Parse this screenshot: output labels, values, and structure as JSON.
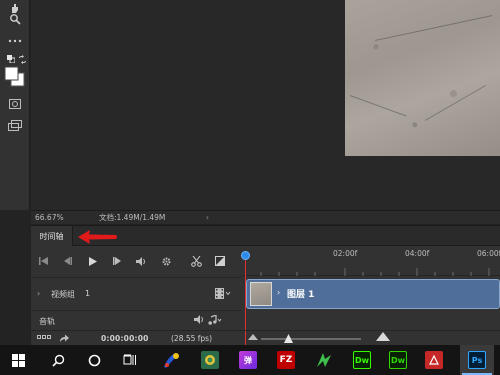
{
  "toolbar": {
    "tools": [
      "hand-tool",
      "zoom-tool",
      "more-tools",
      "default-colors",
      "swap-colors",
      "foreground-background-colors",
      "quick-mask",
      "screen-mode"
    ]
  },
  "status": {
    "zoom": "66.67%",
    "doc_info": "文档:1.49M/1.49M",
    "arrow": "›"
  },
  "timeline": {
    "tab_label": "时间轴",
    "ruler_labels": [
      "02:00f",
      "04:00f",
      "06:00f"
    ],
    "track": {
      "name": "视频组",
      "number": "1"
    },
    "clip_label": "图层 1",
    "audio_label": "音轨",
    "timecode": "0:00:00:00",
    "fps": "(28.55 fps)"
  },
  "taskbar": {
    "apps": [
      {
        "name": "start",
        "label": ""
      },
      {
        "name": "search",
        "label": ""
      },
      {
        "name": "cortana",
        "label": ""
      },
      {
        "name": "task-view",
        "label": ""
      },
      {
        "name": "paint-app",
        "label": ""
      },
      {
        "name": "photo-app",
        "label": ""
      },
      {
        "name": "media-app",
        "label": "弹"
      },
      {
        "name": "filezilla",
        "label": "FZ"
      },
      {
        "name": "green-app",
        "label": ""
      },
      {
        "name": "dreamweaver",
        "label": "Dw"
      },
      {
        "name": "dreamweaver-2",
        "label": "Dw"
      },
      {
        "name": "edge-app",
        "label": ""
      },
      {
        "name": "photoshop",
        "label": "Ps"
      }
    ]
  },
  "colors": {
    "accent_blue": "#2d8ceb",
    "playhead_red": "#e03030",
    "clip_blue": "#4f6f9a",
    "ps_blue": "#31a8ff",
    "dw_green": "#35fa00",
    "fz_red": "#bf0000"
  }
}
